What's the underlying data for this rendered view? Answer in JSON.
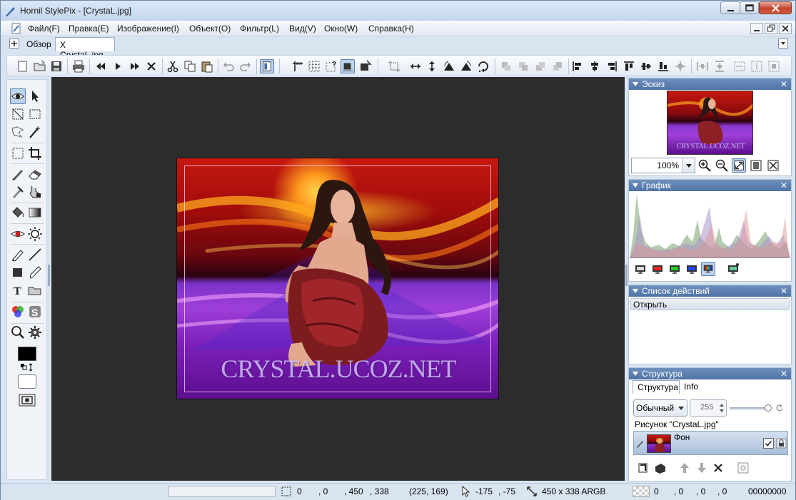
{
  "window": {
    "title": "Hornil StylePix - [CrystaL.jpg]"
  },
  "menu": {
    "items": [
      {
        "label": "Файл(F)"
      },
      {
        "label": "Правка(E)"
      },
      {
        "label": "Изображение(I)"
      },
      {
        "label": "Объект(O)"
      },
      {
        "label": "Фильтр(L)"
      },
      {
        "label": "Вид(V)"
      },
      {
        "label": "Окно(W)"
      },
      {
        "label": "Справка(H)"
      }
    ]
  },
  "tabs": {
    "overview": "Обзор",
    "document": "CrystaL.jpg",
    "document_close": "X"
  },
  "canvas": {
    "watermark": "CRYSTAL.UCOZ.NET"
  },
  "panels": {
    "preview": {
      "title": "Эскиз",
      "zoom": "100%",
      "thumb_watermark": "CRYSTAL.UCOZ.NET"
    },
    "histogram": {
      "title": "График"
    },
    "actions": {
      "title": "Список действий",
      "items": [
        "Открыть"
      ]
    },
    "structure": {
      "title": "Структура",
      "tab_structure": "Структура",
      "tab_info": "Info",
      "blend_mode": "Обычный",
      "opacity": "255",
      "group_label": "Рисунок \"CrystaL.jpg\"",
      "layer_name": "Фон"
    },
    "close_glyph": "✕"
  },
  "colors": {
    "foreground": "#000000",
    "background": "#ffffff",
    "accent": "#4e73a6"
  },
  "status": {
    "sel_x": "0",
    "sel_y": ", 0",
    "sel_w": ", 450",
    "sel_h": ", 338",
    "pixel": "(225, 169)",
    "cursor_x": "-175",
    "cursor_y": ", -75",
    "image_size": "450 x 338 ARGB",
    "color_r": "0",
    "color_g": ", 0",
    "color_b": ", 0",
    "color_a": ", 0",
    "hex": "00000000"
  }
}
